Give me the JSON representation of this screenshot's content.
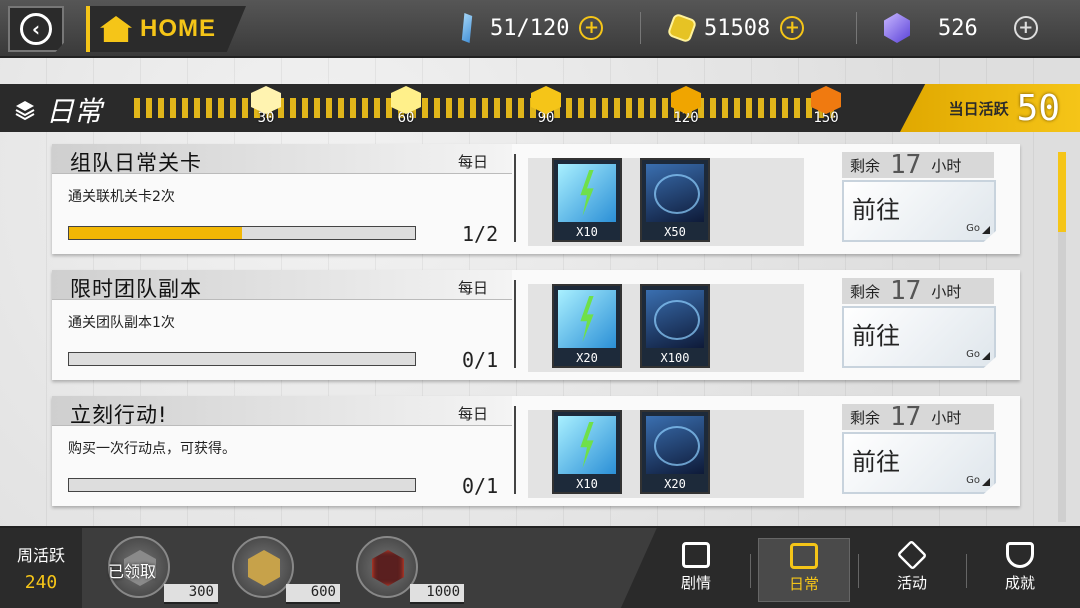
{
  "header": {
    "home_label": "HOME",
    "resources": [
      {
        "icon": "stamina-vial-icon",
        "value": "51/120",
        "has_plus": true
      },
      {
        "icon": "gold-coin-icon",
        "value": "51508",
        "has_plus": true
      },
      {
        "icon": "purple-crystal-icon",
        "value": "526",
        "has_plus": true
      }
    ]
  },
  "activity": {
    "title": "日常",
    "milestones": [
      "30",
      "60",
      "90",
      "120",
      "150"
    ],
    "daily_label": "当日活跃",
    "daily_value": "50"
  },
  "tasks": [
    {
      "name": "组队日常关卡",
      "frequency": "每日",
      "description": "通关联机关卡2次",
      "progress_text": "1/2",
      "progress_fraction": 0.5,
      "rewards": [
        {
          "icon": "energy-bolt-icon",
          "qty": "X10"
        },
        {
          "icon": "exp-card-icon",
          "qty": "X50"
        }
      ],
      "remain_label": "剩余",
      "remain_value": "17",
      "remain_unit": "小时",
      "go_label": "前往",
      "go_sub": "Go"
    },
    {
      "name": "限时团队副本",
      "frequency": "每日",
      "description": "通关团队副本1次",
      "progress_text": "0/1",
      "progress_fraction": 0,
      "rewards": [
        {
          "icon": "energy-bolt-icon",
          "qty": "X20"
        },
        {
          "icon": "exp-card-icon",
          "qty": "X100"
        }
      ],
      "remain_label": "剩余",
      "remain_value": "17",
      "remain_unit": "小时",
      "go_label": "前往",
      "go_sub": "Go"
    },
    {
      "name": "立刻行动!",
      "frequency": "每日",
      "description": "购买一次行动点，可获得。",
      "progress_text": "0/1",
      "progress_fraction": 0,
      "rewards": [
        {
          "icon": "energy-bolt-icon",
          "qty": "X10"
        },
        {
          "icon": "exp-card-icon",
          "qty": "X20"
        }
      ],
      "remain_label": "剩余",
      "remain_value": "17",
      "remain_unit": "小时",
      "go_label": "前往",
      "go_sub": "Go"
    }
  ],
  "weekly": {
    "label": "周活跃",
    "value": "240",
    "chests": [
      {
        "value": "300",
        "claimed_label": "已领取",
        "icon": "grey-chest-icon"
      },
      {
        "value": "600",
        "icon": "gold-chest-icon"
      },
      {
        "value": "1000",
        "icon": "red-chest-icon"
      }
    ]
  },
  "nav": [
    {
      "label": "剧情",
      "icon": "story-icon",
      "active": false
    },
    {
      "label": "日常",
      "icon": "calendar-icon",
      "active": true
    },
    {
      "label": "活动",
      "icon": "event-diamond-icon",
      "active": false
    },
    {
      "label": "成就",
      "icon": "trophy-icon",
      "active": false
    }
  ],
  "colors": {
    "accent": "#f5c518",
    "dark": "#2a2a2a"
  }
}
